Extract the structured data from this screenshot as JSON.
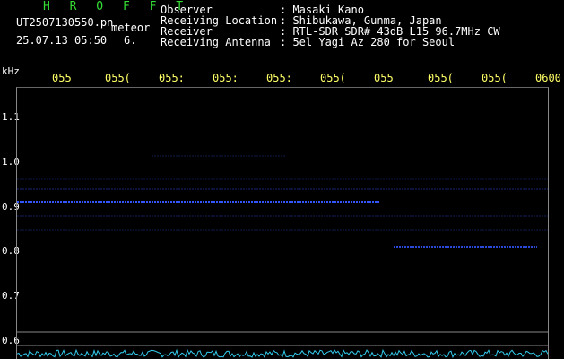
{
  "header": {
    "title": "H R O F F T",
    "filename": "UT2507130550.pn",
    "meteor_label": "meteor",
    "datetime": "25.07.13 05:50",
    "count": "6.",
    "info": [
      {
        "label": "Observer",
        "value": ": Masaki Kano"
      },
      {
        "label": "Receiving Location",
        "value": ": Shibukawa, Gunma, Japan"
      },
      {
        "label": "Receiver",
        "value": ": RTL-SDR SDR# 43dB L15 96.7MHz CW"
      },
      {
        "label": "Receiving Antenna",
        "value": ": 5el Yagi Az 280 for Seoul"
      }
    ]
  },
  "axis": {
    "freq_unit": "kHz",
    "freq_labels": [
      "1.1",
      "1.0",
      "0.9",
      "0.8",
      "0.7",
      "0.6"
    ],
    "time_labels": [
      "055",
      "055(",
      "055:",
      "055:",
      "055:",
      "055(",
      "055",
      "055(",
      "055(",
      "0600"
    ]
  },
  "colors": {
    "title": "#33dd33",
    "text": "#ffffff",
    "time_labels": "#ffff66",
    "signal": "#3355ff",
    "noise_floor": "#33ccee"
  }
}
